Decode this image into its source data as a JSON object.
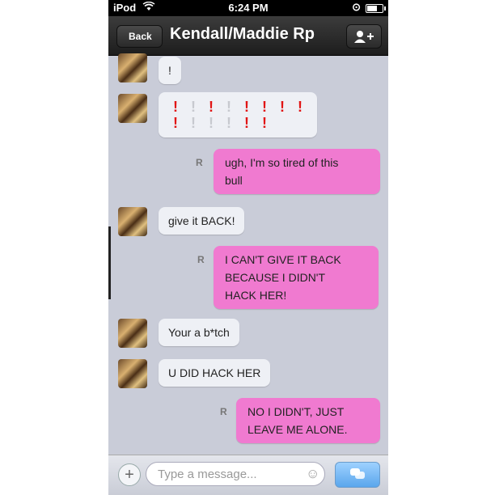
{
  "status_bar": {
    "carrier": "iPod",
    "wifi_icon": "wifi-icon",
    "time": "6:24 PM",
    "lock_icon": "orientation-lock-icon",
    "battery_icon": "battery-icon"
  },
  "nav": {
    "back_label": "Back",
    "title": "Kendall/Maddie Rp",
    "add_user_icon": "add-user-icon"
  },
  "messages": [
    {
      "direction": "in",
      "text": "!"
    },
    {
      "direction": "in",
      "type": "exclamation-emoji-grid",
      "row1": [
        "red",
        "gray",
        "red",
        "gray",
        "red",
        "red",
        "red",
        "red"
      ],
      "row2": [
        "red",
        "gray",
        "gray",
        "gray",
        "red",
        "red"
      ]
    },
    {
      "direction": "out",
      "read_mark": "R",
      "line1": "ugh, I'm so tired of this",
      "line2": "bull"
    },
    {
      "direction": "in",
      "text": "give it BACK!"
    },
    {
      "direction": "out",
      "read_mark": "R",
      "line1": "I CAN'T GIVE IT BACK",
      "line2": "BECAUSE I DIDN'T",
      "line3": "HACK HER!"
    },
    {
      "direction": "in",
      "text": "Your a b*tch"
    },
    {
      "direction": "in",
      "text": "U DID HACK HER"
    },
    {
      "direction": "out",
      "read_mark": "R",
      "line1": "NO I DIDN'T, JUST",
      "line2": "LEAVE ME ALONE."
    }
  ],
  "input_bar": {
    "plus_label": "+",
    "placeholder": "Type a message...",
    "emoji_icon": "smiley-icon",
    "send_icon": "send-bubble-icon"
  },
  "colors": {
    "outgoing_bubble": "#f07ad0",
    "incoming_bubble": "#eef0f5",
    "background": "#c9ccd8",
    "send_button": "#5aa6ec",
    "exclamation_red": "#e11515"
  }
}
